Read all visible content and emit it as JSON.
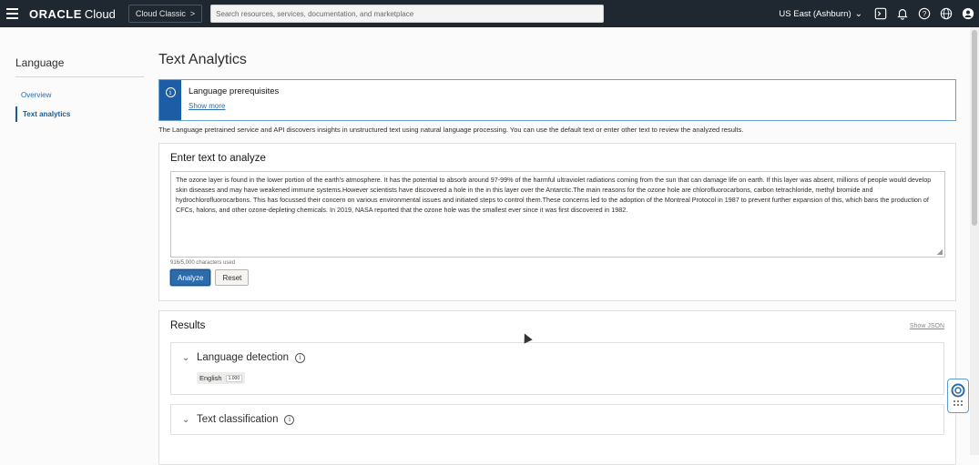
{
  "topbar": {
    "brand_bold": "ORACLE",
    "brand_light": "Cloud",
    "classic_label": "Cloud Classic",
    "search_placeholder": "Search resources, services, documentation, and marketplace",
    "region": "US East (Ashburn)",
    "icons": [
      "cloud-shell-icon",
      "bell-icon",
      "help-icon",
      "globe-icon",
      "profile-icon"
    ]
  },
  "leftnav": {
    "title": "Language",
    "items": [
      {
        "label": "Overview",
        "active": false
      },
      {
        "label": "Text analytics",
        "active": true
      }
    ]
  },
  "main": {
    "page_title": "Text Analytics",
    "info": {
      "heading": "Language prerequisites",
      "link": "Show more"
    },
    "description": "The Language pretrained service and API discovers insights in unstructured text using natural language processing. You can use the default text or enter other text to review the analyzed results.",
    "enter": {
      "title": "Enter text to analyze",
      "text": "The ozone layer is found in the lower portion of the earth's atmosphere. It has the potential to absorb around 97-99% of the harmful ultraviolet radiations coming from the sun that can damage life on earth. If this layer was absent, millions of people would develop skin diseases and may have weakened immune systems.However scientists have discovered a hole in the in this layer over the Antarctic.The main reasons for the ozone hole are chlorofluorocarbons, carbon tetrachloride, methyl bromide and hydrochlorofluorocarbons. This has focussed their concern on various environmental issues and initiated steps to control them.These concerns led to the adoption of the Montreal Protocol in 1987 to prevent further expansion of this, which bans the production of CFCs, halons, and other ozone-depleting chemicals. In 2019, NASA reported that the ozone hole was the smallest ever since it was first discovered in 1982.",
      "char_count": "916/5,000 characters used",
      "analyze_label": "Analyze",
      "reset_label": "Reset"
    },
    "results": {
      "title": "Results",
      "show_json": "Show JSON",
      "language_detection": {
        "title": "Language detection",
        "tag": "English",
        "score": "1.000"
      },
      "text_classification": {
        "title": "Text classification"
      }
    }
  },
  "colors": {
    "topbar_bg": "#1f2730",
    "accent": "#2c6bac",
    "info_bar": "#1c5da5"
  }
}
